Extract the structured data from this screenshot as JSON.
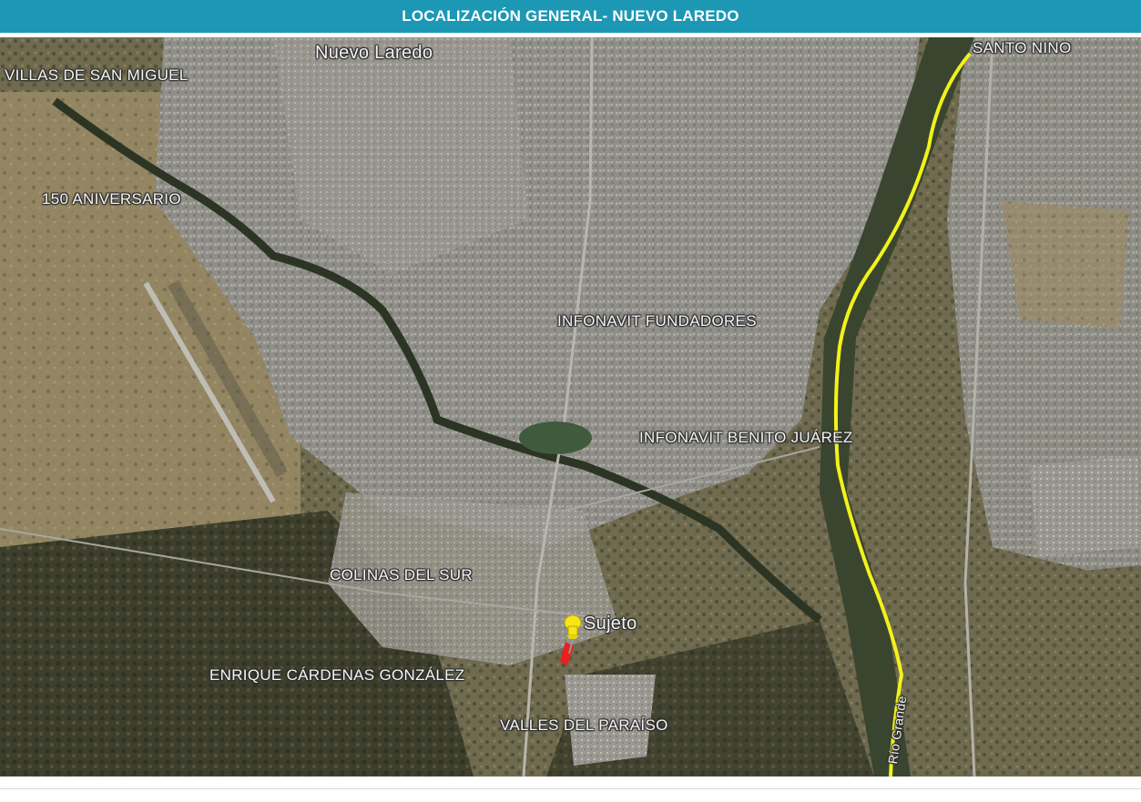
{
  "header": {
    "title": "LOCALIZACIÓN GENERAL- NUEVO LAREDO",
    "background": "#1c97b4",
    "text_color": "#ffffff"
  },
  "map": {
    "type": "satellite",
    "labels": {
      "city": "Nuevo Laredo",
      "villas": "VILLAS DE SAN MIGUEL",
      "aniversario": "150 ANIVERSARIO",
      "santo_nino": "SANTO NINO",
      "fundadores": "INFONAVIT FUNDADORES",
      "benito": "INFONAVIT BENITO JUÁREZ",
      "colinas": "COLINAS DEL SUR",
      "enrique": "ENRIQUE CÁRDENAS GONZÁLEZ",
      "valles": "VALLES DEL PARAÍSO",
      "subject": "Sujeto",
      "river": "Río Grande"
    },
    "river_color": "#f2f21a",
    "pin_color": "#f5e51a",
    "parcel_color": "#e82020",
    "marker_icon": "pushpin-icon"
  }
}
